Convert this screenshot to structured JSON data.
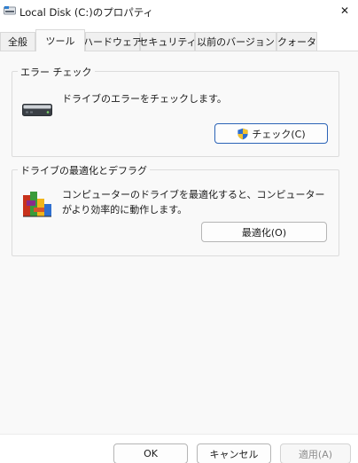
{
  "window": {
    "title": "Local Disk (C:)のプロパティ",
    "close_glyph": "✕"
  },
  "tabs": [
    {
      "label": "全般",
      "active": false
    },
    {
      "label": "ツール",
      "active": true
    },
    {
      "label": "ハードウェア",
      "active": false
    },
    {
      "label": "セキュリティ",
      "active": false
    },
    {
      "label": "以前のバージョン",
      "active": false
    },
    {
      "label": "クォータ",
      "active": false
    }
  ],
  "error_check": {
    "title": "エラー チェック",
    "description": "ドライブのエラーをチェックします。",
    "button_label": "チェック(C)",
    "icon": "drive-icon",
    "button_icon": "uac-shield-icon"
  },
  "optimize": {
    "title": "ドライブの最適化とデフラグ",
    "description": "コンピューターのドライブを最適化すると、コンピューターがより効率的に動作します。",
    "button_label": "最適化(O)",
    "icon": "defrag-icon"
  },
  "footer": {
    "ok_label": "OK",
    "cancel_label": "キャンセル",
    "apply_label": "適用(A)"
  },
  "colors": {
    "accent_border": "#2b63b7",
    "panel_bg": "#f9f9f9",
    "disabled_text": "#8d8d8d"
  }
}
